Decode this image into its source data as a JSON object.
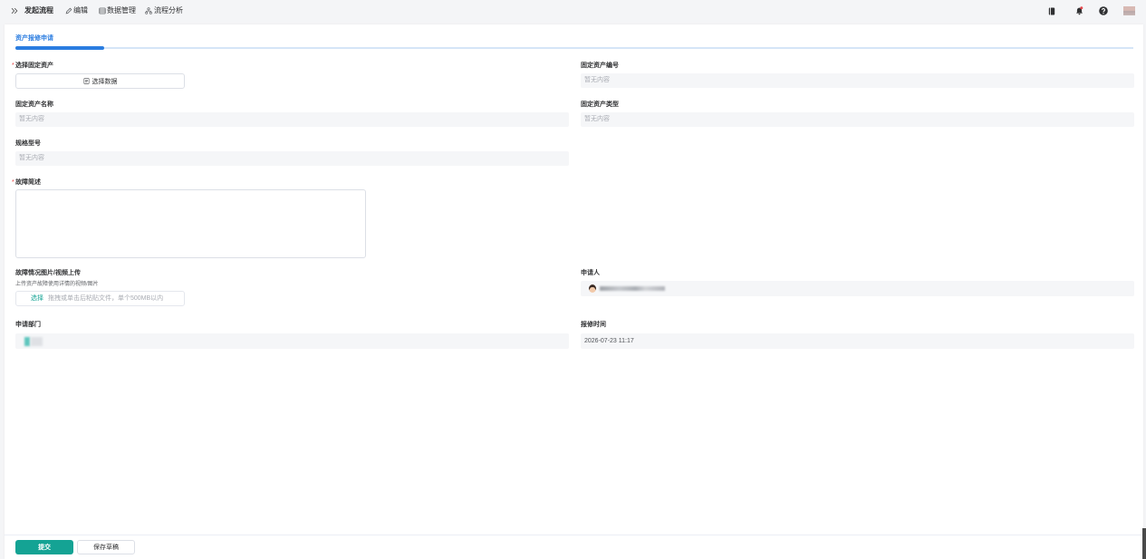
{
  "topbar": {
    "toggle_icon": "double-chevron-right-icon",
    "title": "发起流程",
    "actions": [
      {
        "icon": "edit-icon",
        "label": "编辑"
      },
      {
        "icon": "table-icon",
        "label": "数据管理"
      },
      {
        "icon": "flow-analysis-icon",
        "label": "流程分析"
      }
    ],
    "right_icons": [
      "book-icon",
      "bell-icon",
      "help-icon",
      "user-avatar"
    ],
    "notification_dot": true
  },
  "tab": {
    "active_label": "资产报修申请"
  },
  "form": {
    "required_mark": "*",
    "select_asset": {
      "label": "选择固定资产",
      "required": true,
      "button_label": "选择数据",
      "button_icon": "document-icon"
    },
    "asset_code": {
      "label": "固定资产编号",
      "placeholder": "暂无内容"
    },
    "asset_name": {
      "label": "固定资产名称",
      "placeholder": "暂无内容"
    },
    "asset_type": {
      "label": "固定资产类型",
      "placeholder": "暂无内容"
    },
    "spec_model": {
      "label": "规格型号",
      "placeholder": "暂无内容"
    },
    "fault_desc": {
      "label": "故障简述",
      "required": true,
      "value": ""
    },
    "upload": {
      "label": "故障情况图片/视频上传",
      "hint": "上传资产故障使用详情的视频/图片",
      "select_label": "选择",
      "drop_text": "拖拽或单击后粘贴文件，单个500MB以内"
    },
    "applicant": {
      "label": "申请人"
    },
    "department": {
      "label": "申请部门"
    },
    "report_time": {
      "label": "报修时间",
      "value": "2026-07-23 11:17"
    }
  },
  "footer": {
    "submit_label": "提交",
    "save_draft_label": "保存草稿"
  },
  "colors": {
    "primary": "#14a394",
    "tab_blue": "#2b7de0",
    "required_red": "#e64545",
    "notification_red": "#e5484d"
  }
}
